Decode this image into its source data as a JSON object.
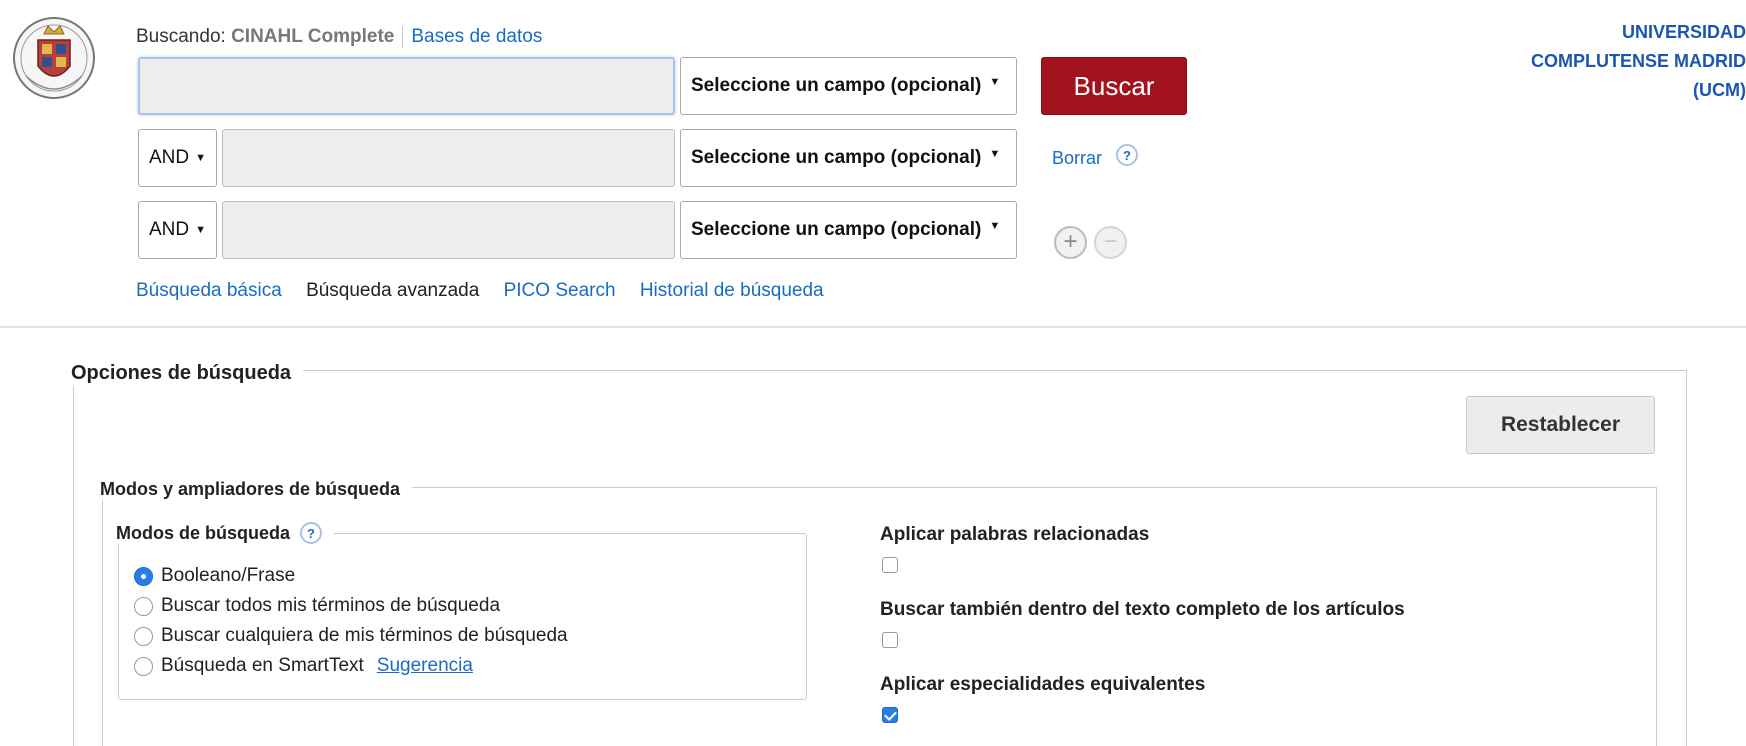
{
  "header": {
    "searching_label": "Buscando:",
    "database_name": "CINAHL Complete",
    "databases_link": "Bases de datos",
    "institution_lines": [
      "UNIVERSIDAD",
      "COMPLUTENSE MADRID",
      "(UCM)"
    ]
  },
  "search_rows": [
    {
      "operator": null,
      "value": "",
      "field": "Seleccione un campo (opcional)"
    },
    {
      "operator": "AND",
      "value": "",
      "field": "Seleccione un campo (opcional)"
    },
    {
      "operator": "AND",
      "value": "",
      "field": "Seleccione un campo (opcional)"
    }
  ],
  "buttons": {
    "search": "Buscar",
    "clear": "Borrar",
    "help": "?",
    "add_row": "+",
    "remove_row": "−",
    "reset": "Restablecer"
  },
  "tabs": [
    {
      "label": "Búsqueda básica",
      "active": false
    },
    {
      "label": "Búsqueda avanzada",
      "active": true
    },
    {
      "label": "PICO Search",
      "active": false
    },
    {
      "label": "Historial de búsqueda",
      "active": false
    }
  ],
  "search_options": {
    "title": "Opciones de búsqueda",
    "modes_section_title": "Modos y ampliadores de búsqueda",
    "search_modes_title": "Modos de búsqueda",
    "modes": [
      {
        "label": "Booleano/Frase",
        "selected": true
      },
      {
        "label": "Buscar todos mis términos de búsqueda",
        "selected": false
      },
      {
        "label": "Buscar cualquiera de mis términos de búsqueda",
        "selected": false
      },
      {
        "label": "Búsqueda en SmartText",
        "selected": false
      }
    ],
    "smarttext_hint": "Sugerencia",
    "expanders": [
      {
        "label": "Aplicar palabras relacionadas",
        "checked": false
      },
      {
        "label": "Buscar también dentro del texto completo de los artículos",
        "checked": false
      },
      {
        "label": "Aplicar especialidades equivalentes",
        "checked": true
      }
    ]
  },
  "colors": {
    "search_button": "#a3131e",
    "link": "#1a6bc4",
    "institution": "#1a56b0",
    "accent": "#2a7de1"
  },
  "icons": {
    "logo": "ucm-crest-logo",
    "help": "help-icon",
    "add": "plus-circle-icon",
    "remove": "minus-circle-icon",
    "dropdown": "caret-down-icon"
  }
}
